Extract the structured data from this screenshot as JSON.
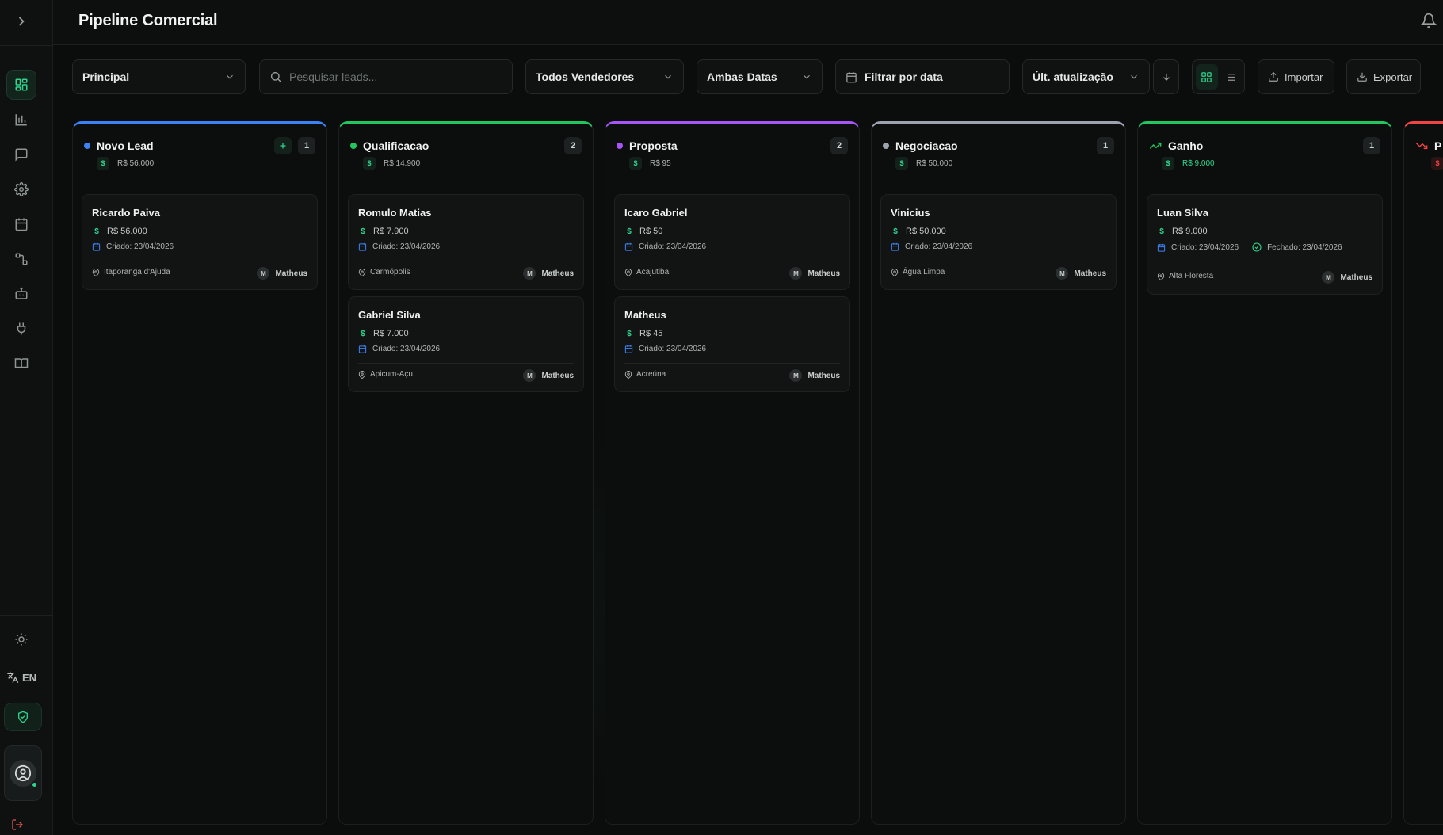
{
  "header": {
    "title": "Pipeline Comercial"
  },
  "sidebar": {
    "lang": "EN",
    "avatar_initial": ""
  },
  "toolbar": {
    "pipeline_select": "Principal",
    "search_placeholder": "Pesquisar leads...",
    "sellers_select": "Todos Vendedores",
    "dates_select": "Ambas Datas",
    "date_filter": "Filtrar por data",
    "sort_select": "Últ. atualização",
    "import_label": "Importar",
    "export_label": "Exportar"
  },
  "columns": [
    {
      "title": "Novo Lead",
      "count": "1",
      "total": "R$ 56.000",
      "color": "#3b82f6",
      "cards": [
        {
          "name": "Ricardo Paiva",
          "value": "R$ 56.000",
          "created": "Criado: 23/04/2026",
          "location": "Itaporanga d'Ajuda",
          "owner_initial": "M",
          "owner": "Matheus"
        }
      ]
    },
    {
      "title": "Qualificacao",
      "count": "2",
      "total": "R$ 14.900",
      "color": "#22c55e",
      "cards": [
        {
          "name": "Romulo Matias",
          "value": "R$ 7.900",
          "created": "Criado: 23/04/2026",
          "location": "Carmópolis",
          "owner_initial": "M",
          "owner": "Matheus"
        },
        {
          "name": "Gabriel Silva",
          "value": "R$ 7.000",
          "created": "Criado: 23/04/2026",
          "location": "Apicum-Açu",
          "owner_initial": "M",
          "owner": "Matheus"
        }
      ]
    },
    {
      "title": "Proposta",
      "count": "2",
      "total": "R$ 95",
      "color": "#a855f7",
      "cards": [
        {
          "name": "Icaro Gabriel",
          "value": "R$ 50",
          "created": "Criado: 23/04/2026",
          "location": "Acajutiba",
          "owner_initial": "M",
          "owner": "Matheus"
        },
        {
          "name": "Matheus",
          "value": "R$ 45",
          "created": "Criado: 23/04/2026",
          "location": "Acreúna",
          "owner_initial": "M",
          "owner": "Matheus"
        }
      ]
    },
    {
      "title": "Negociacao",
      "count": "1",
      "total": "R$ 50.000",
      "color": "#9ca3af",
      "cards": [
        {
          "name": "Vinicius",
          "value": "R$ 50.000",
          "created": "Criado: 23/04/2026",
          "location": "Água Limpa",
          "owner_initial": "M",
          "owner": "Matheus"
        }
      ]
    },
    {
      "title": "Ganho",
      "count": "1",
      "total": "R$ 9.000",
      "color": "#22c55e",
      "cards": [
        {
          "name": "Luan Silva",
          "value": "R$ 9.000",
          "created": "Criado: 23/04/2026",
          "closed": "Fechado: 23/04/2026",
          "location": "Alta Floresta",
          "owner_initial": "M",
          "owner": "Matheus"
        }
      ]
    },
    {
      "title": "P",
      "color": "#ef4444"
    }
  ]
}
